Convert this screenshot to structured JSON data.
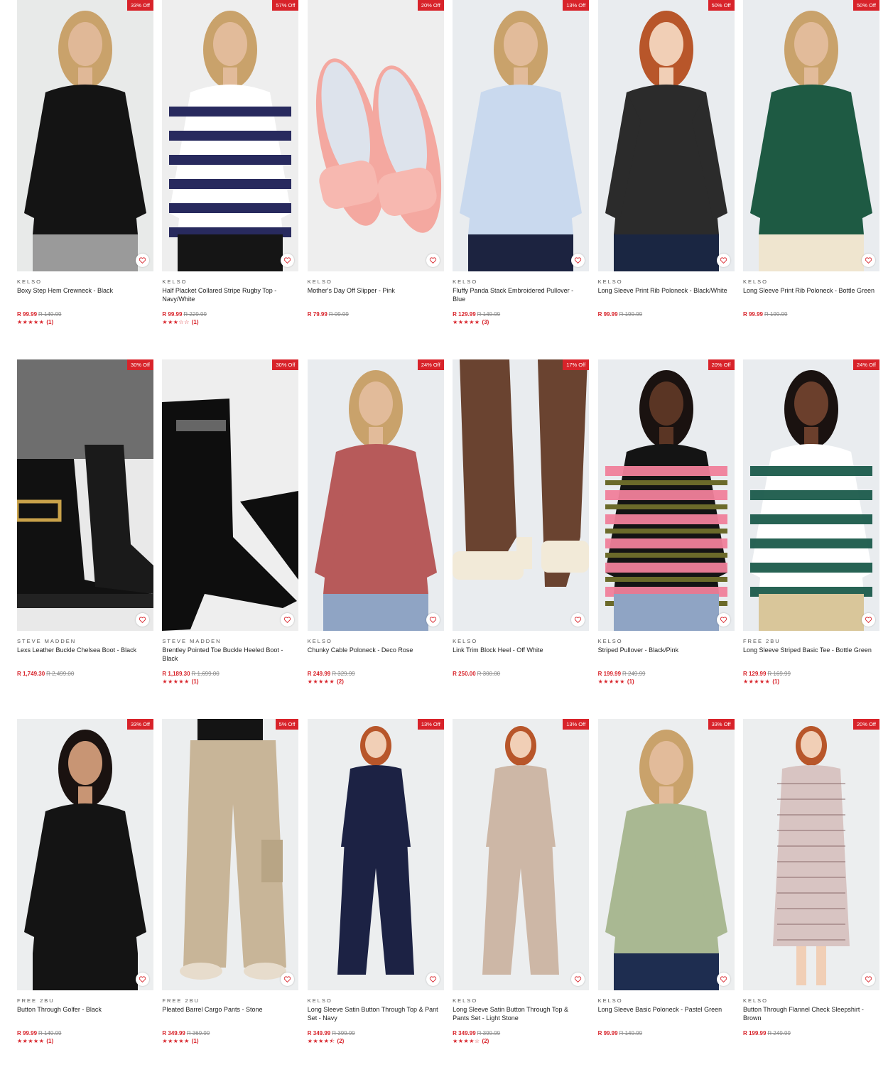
{
  "colors": {
    "accent": "#d8232a",
    "heart": "#d8232a"
  },
  "products": [
    {
      "badge": "33% Off",
      "brand": "KELSO",
      "title": "Boxy Step Hem Crewneck - Black",
      "price": "R 99.99",
      "was": "R 149.99",
      "stars": "★★★★★",
      "rating": 5,
      "count": "(1)",
      "img": {
        "kind": "top",
        "bg": "#e8eae9",
        "garment": "#141414",
        "skin": "#e0b897",
        "hair": "#c9a26b",
        "pants": "#9a9a9a"
      }
    },
    {
      "badge": "57% Off",
      "brand": "KELSO",
      "title": "Half Placket Collared Stripe Rugby Top - Navy/White",
      "price": "R 99.99",
      "was": "R 229.99",
      "stars": "★★★☆☆",
      "rating": 3,
      "count": "(1)",
      "img": {
        "kind": "stripe",
        "bg": "#eeeeee",
        "garment": "#ffffff",
        "stripe": "#1c1f55",
        "skin": "#e2bb9a",
        "hair": "#c9a26b",
        "pants": "#151515"
      }
    },
    {
      "badge": "20% Off",
      "brand": "KELSO",
      "title": "Mother's Day Off Slipper - Pink",
      "price": "R 79.99",
      "was": "R 99.99",
      "stars": "",
      "rating": 0,
      "count": "",
      "img": {
        "kind": "slipper",
        "bg": "#eeeeee",
        "garment": "#f4a8a0",
        "inner": "#dde3ec"
      }
    },
    {
      "badge": "13% Off",
      "brand": "KELSO",
      "title": "Fluffy Panda Stack Embroidered Pullover - Blue",
      "price": "R 129.99",
      "was": "R 149.99",
      "stars": "★★★★★",
      "rating": 5,
      "count": "(3)",
      "img": {
        "kind": "top",
        "bg": "#e9ecef",
        "garment": "#c9d9ee",
        "skin": "#e2bb9a",
        "hair": "#c9a26b",
        "pants": "#1c2340"
      }
    },
    {
      "badge": "50% Off",
      "brand": "KELSO",
      "title": "Long Sleeve Print Rib Poloneck - Black/White",
      "price": "R 99.99",
      "was": "R 199.99",
      "stars": "",
      "rating": 0,
      "count": "",
      "img": {
        "kind": "top",
        "bg": "#e9ecef",
        "garment": "#2b2b2b",
        "skin": "#f1cfb6",
        "hair": "#b8562a",
        "pants": "#1a2642"
      }
    },
    {
      "badge": "50% Off",
      "brand": "KELSO",
      "title": "Long Sleeve Print Rib Poloneck - Bottle Green",
      "price": "R 99.99",
      "was": "R 199.99",
      "stars": "",
      "rating": 0,
      "count": "",
      "img": {
        "kind": "top",
        "bg": "#e9ecef",
        "garment": "#1e5a43",
        "skin": "#e2bb9a",
        "hair": "#c9a26b",
        "pants": "#efe5cf"
      }
    },
    {
      "badge": "30% Off",
      "brand": "STEVE MADDEN",
      "title": "Lexs Leather Buckle Chelsea Boot - Black",
      "price": "R 1,749.30",
      "was": "R 2,499.00",
      "stars": "",
      "rating": 0,
      "count": "",
      "img": {
        "kind": "boot",
        "bg": "#e9e9e9",
        "garment": "#111111",
        "pants": "#6e6e6e"
      }
    },
    {
      "badge": "30% Off",
      "brand": "STEVE MADDEN",
      "title": "Brentley Pointed Toe Buckle Heeled Boot - Black",
      "price": "R 1,189.30",
      "was": "R 1,699.00",
      "stars": "★★★★★",
      "rating": 5,
      "count": "(1)",
      "img": {
        "kind": "boot2",
        "bg": "#eeeeee",
        "garment": "#0e0e0e"
      }
    },
    {
      "badge": "24% Off",
      "brand": "KELSO",
      "title": "Chunky Cable Poloneck - Deco Rose",
      "price": "R 249.99",
      "was": "R 329.99",
      "stars": "★★★★★",
      "rating": 5,
      "count": "(2)",
      "img": {
        "kind": "top",
        "bg": "#e9ecef",
        "garment": "#b75a5a",
        "skin": "#e2bb9a",
        "hair": "#c9a26b",
        "pants": "#8fa4c4"
      }
    },
    {
      "badge": "17% Off",
      "brand": "KELSO",
      "title": "Link Trim Block Heel - Off White",
      "price": "R 250.00",
      "was": "R 300.00",
      "stars": "",
      "rating": 0,
      "count": "",
      "img": {
        "kind": "heel",
        "bg": "#e9ecef",
        "garment": "#f2ead8",
        "skin": "#6a4330"
      }
    },
    {
      "badge": "20% Off",
      "brand": "KELSO",
      "title": "Striped Pullover - Black/Pink",
      "price": "R 199.99",
      "was": "R 249.99",
      "stars": "★★★★★",
      "rating": 5,
      "count": "(1)",
      "img": {
        "kind": "stripe",
        "bg": "#e9ecef",
        "garment": "#141414",
        "stripe": "#f07f9a",
        "stripe2": "#6b6a2a",
        "skin": "#5a3524",
        "hair": "#1a1210",
        "pants": "#8fa4c4"
      }
    },
    {
      "badge": "24% Off",
      "brand": "FREE 2BU",
      "title": "Long Sleeve Striped Basic Tee - Bottle Green",
      "price": "R 129.99",
      "was": "R 169.99",
      "stars": "★★★★★",
      "rating": 5,
      "count": "(1)",
      "img": {
        "kind": "stripe",
        "bg": "#e9ecef",
        "garment": "#ffffff",
        "stripe": "#1b5b4b",
        "skin": "#6b3f2c",
        "hair": "#1a1210",
        "pants": "#d9c69a"
      }
    },
    {
      "badge": "33% Off",
      "brand": "FREE 2BU",
      "title": "Button Through Golfer - Black",
      "price": "R 99.99",
      "was": "R 149.99",
      "stars": "★★★★★",
      "rating": 5,
      "count": "(1)",
      "img": {
        "kind": "top",
        "bg": "#eceeef",
        "garment": "#141414",
        "skin": "#c89574",
        "hair": "#1a1210",
        "pants": "#141414"
      }
    },
    {
      "badge": "5% Off",
      "brand": "FREE 2BU",
      "title": "Pleated Barrel Cargo Pants - Stone",
      "price": "R 349.99",
      "was": "R 369.99",
      "stars": "★★★★★",
      "rating": 5,
      "count": "(1)",
      "img": {
        "kind": "pants",
        "bg": "#eceeef",
        "garment": "#c8b598",
        "top": "#141414"
      }
    },
    {
      "badge": "13% Off",
      "brand": "KELSO",
      "title": "Long Sleeve Satin Button Through Top & Pant Set - Navy",
      "price": "R 349.99",
      "was": "R 399.99",
      "stars": "★★★★⯪",
      "rating": 4.5,
      "count": "(2)",
      "img": {
        "kind": "full",
        "bg": "#eceeef",
        "garment": "#1c2244",
        "skin": "#f1cfb6",
        "hair": "#b8562a"
      }
    },
    {
      "badge": "13% Off",
      "brand": "KELSO",
      "title": "Long Sleeve Satin Button Through Top & Pants Set - Light Stone",
      "price": "R 349.99",
      "was": "R 399.99",
      "stars": "★★★★☆",
      "rating": 4,
      "count": "(2)",
      "img": {
        "kind": "full",
        "bg": "#eceeef",
        "garment": "#cdb7a6",
        "skin": "#f1cfb6",
        "hair": "#b8562a"
      }
    },
    {
      "badge": "33% Off",
      "brand": "KELSO",
      "title": "Long Sleeve Basic Poloneck - Pastel Green",
      "price": "R 99.99",
      "was": "R 149.99",
      "stars": "",
      "rating": 0,
      "count": "",
      "img": {
        "kind": "top",
        "bg": "#eceeef",
        "garment": "#a9b892",
        "skin": "#e2bb9a",
        "hair": "#c9a26b",
        "pants": "#1e2d50"
      }
    },
    {
      "badge": "20% Off",
      "brand": "KELSO",
      "title": "Button Through Flannel Check Sleepshirt - Brown",
      "price": "R 199.99",
      "was": "R 249.99",
      "stars": "",
      "rating": 0,
      "count": "",
      "img": {
        "kind": "dress",
        "bg": "#eceeef",
        "garment": "#d8c4c2",
        "stripe": "#8a6a6a",
        "skin": "#f1cfb6",
        "hair": "#b8562a"
      }
    }
  ]
}
